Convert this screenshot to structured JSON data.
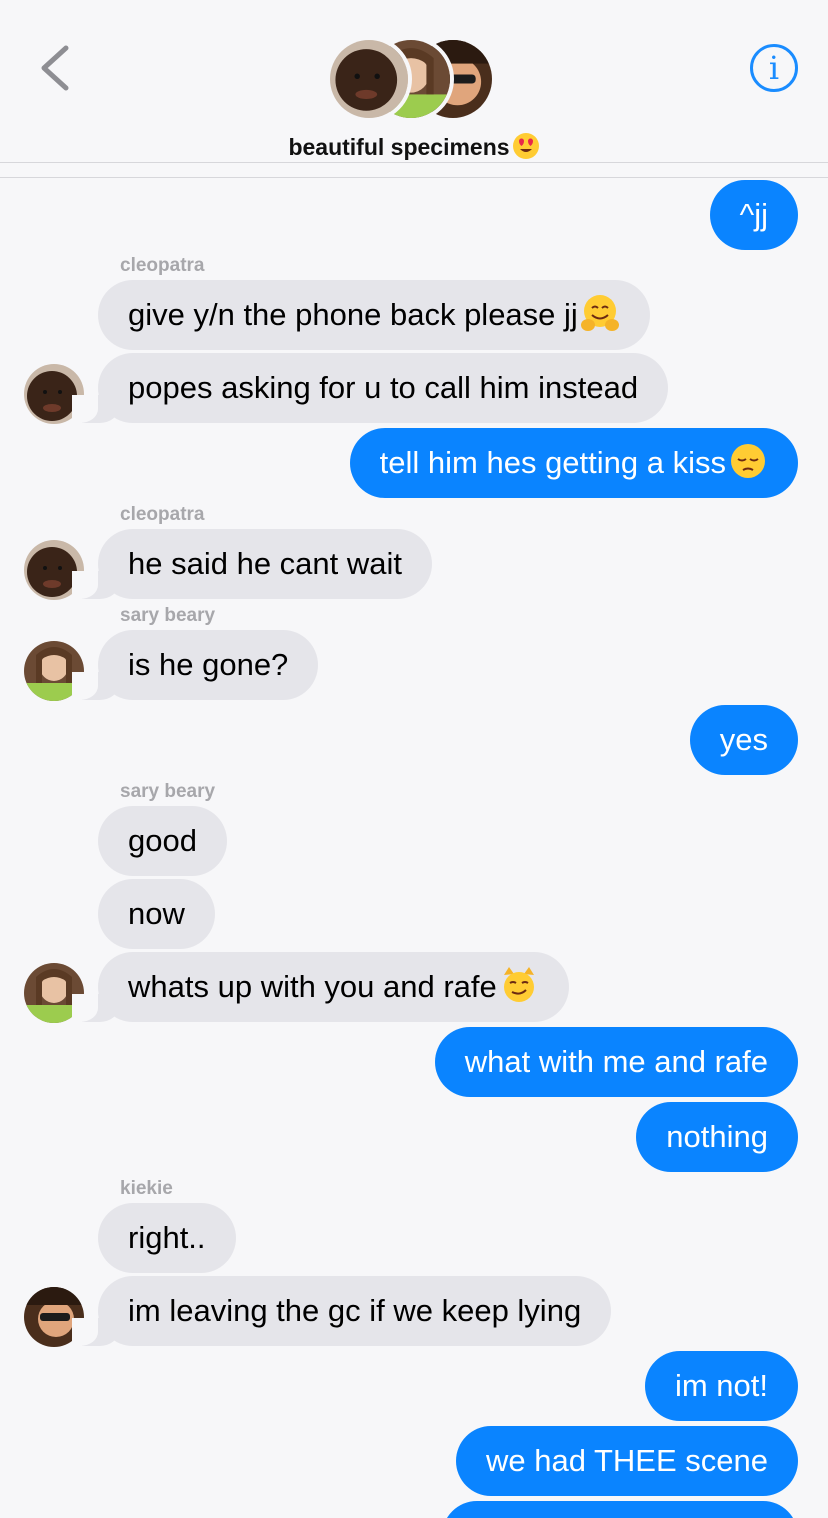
{
  "header": {
    "group_name": "beautiful specimens",
    "group_emoji": "heart-eyes-emoji",
    "back_icon": "chevron-left-icon",
    "info_icon": "info-icon",
    "info_glyph": "i"
  },
  "colors": {
    "outgoing_bubble": "#0a84ff",
    "incoming_bubble": "#e5e5ea",
    "accent": "#1a8cff",
    "sender_label": "#a7a7ab"
  },
  "senders": {
    "cleopatra_1": "cleopatra",
    "cleopatra_2": "cleopatra",
    "sary_1": "sary beary",
    "sary_2": "sary beary",
    "kiekie": "kiekie"
  },
  "messages": {
    "m1": "^jj",
    "m2": "give y/n the phone back please jj",
    "m2_emoji": "hugging-face-emoji",
    "m3": "popes asking for u to call him instead",
    "m4": "tell him hes getting a kiss",
    "m4_emoji": "pensive-face-emoji",
    "m5": "he said he cant wait",
    "m6": "is he gone?",
    "m7": "yes",
    "m8": "good",
    "m9": "now",
    "m10": "whats up with you and rafe",
    "m10_emoji": "smirking-cat-emoji",
    "m11": "what with me and rafe",
    "m12": "nothing",
    "m13": "right..",
    "m14": "im leaving the gc if we keep lying",
    "m15": "im not!",
    "m16": "we had THEE scene"
  }
}
